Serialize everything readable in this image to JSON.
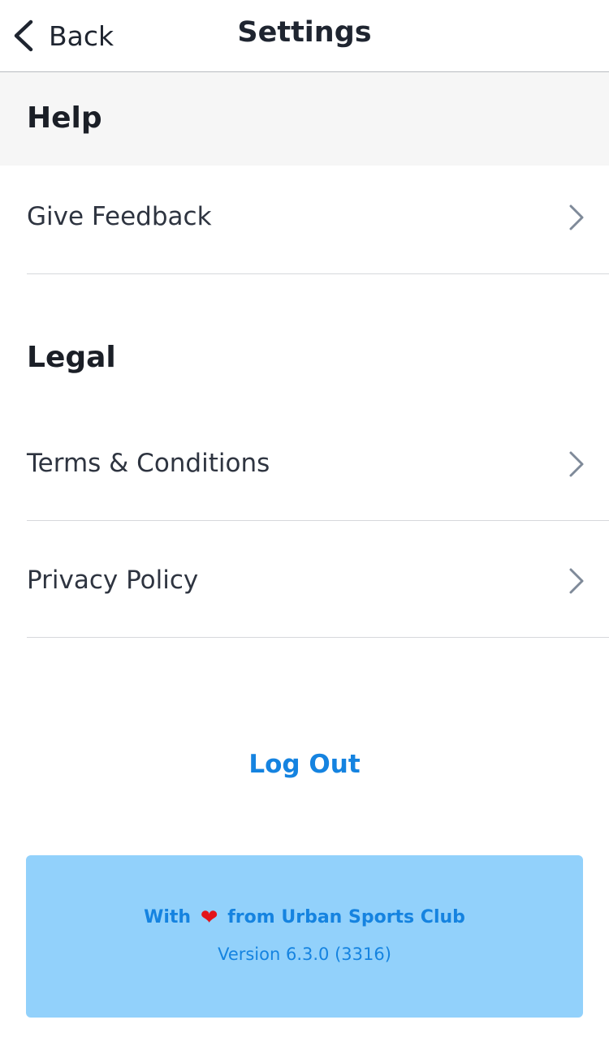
{
  "nav": {
    "back_label": "Back",
    "title": "Settings"
  },
  "sections": {
    "help": {
      "title": "Help",
      "items": [
        {
          "label": "Give Feedback"
        }
      ]
    },
    "legal": {
      "title": "Legal",
      "items": [
        {
          "label": "Terms & Conditions"
        },
        {
          "label": "Privacy Policy"
        }
      ]
    }
  },
  "logout_label": "Log Out",
  "footer": {
    "with_text": "With",
    "heart_icon": "heart-icon",
    "from_text": "from Urban Sports Club",
    "version_text": "Version 6.3.0 (3316)"
  },
  "colors": {
    "accent": "#1583e0",
    "footer_bg": "#92d1fb",
    "section_bg": "#f6f6f6",
    "heart": "#e3141a"
  }
}
